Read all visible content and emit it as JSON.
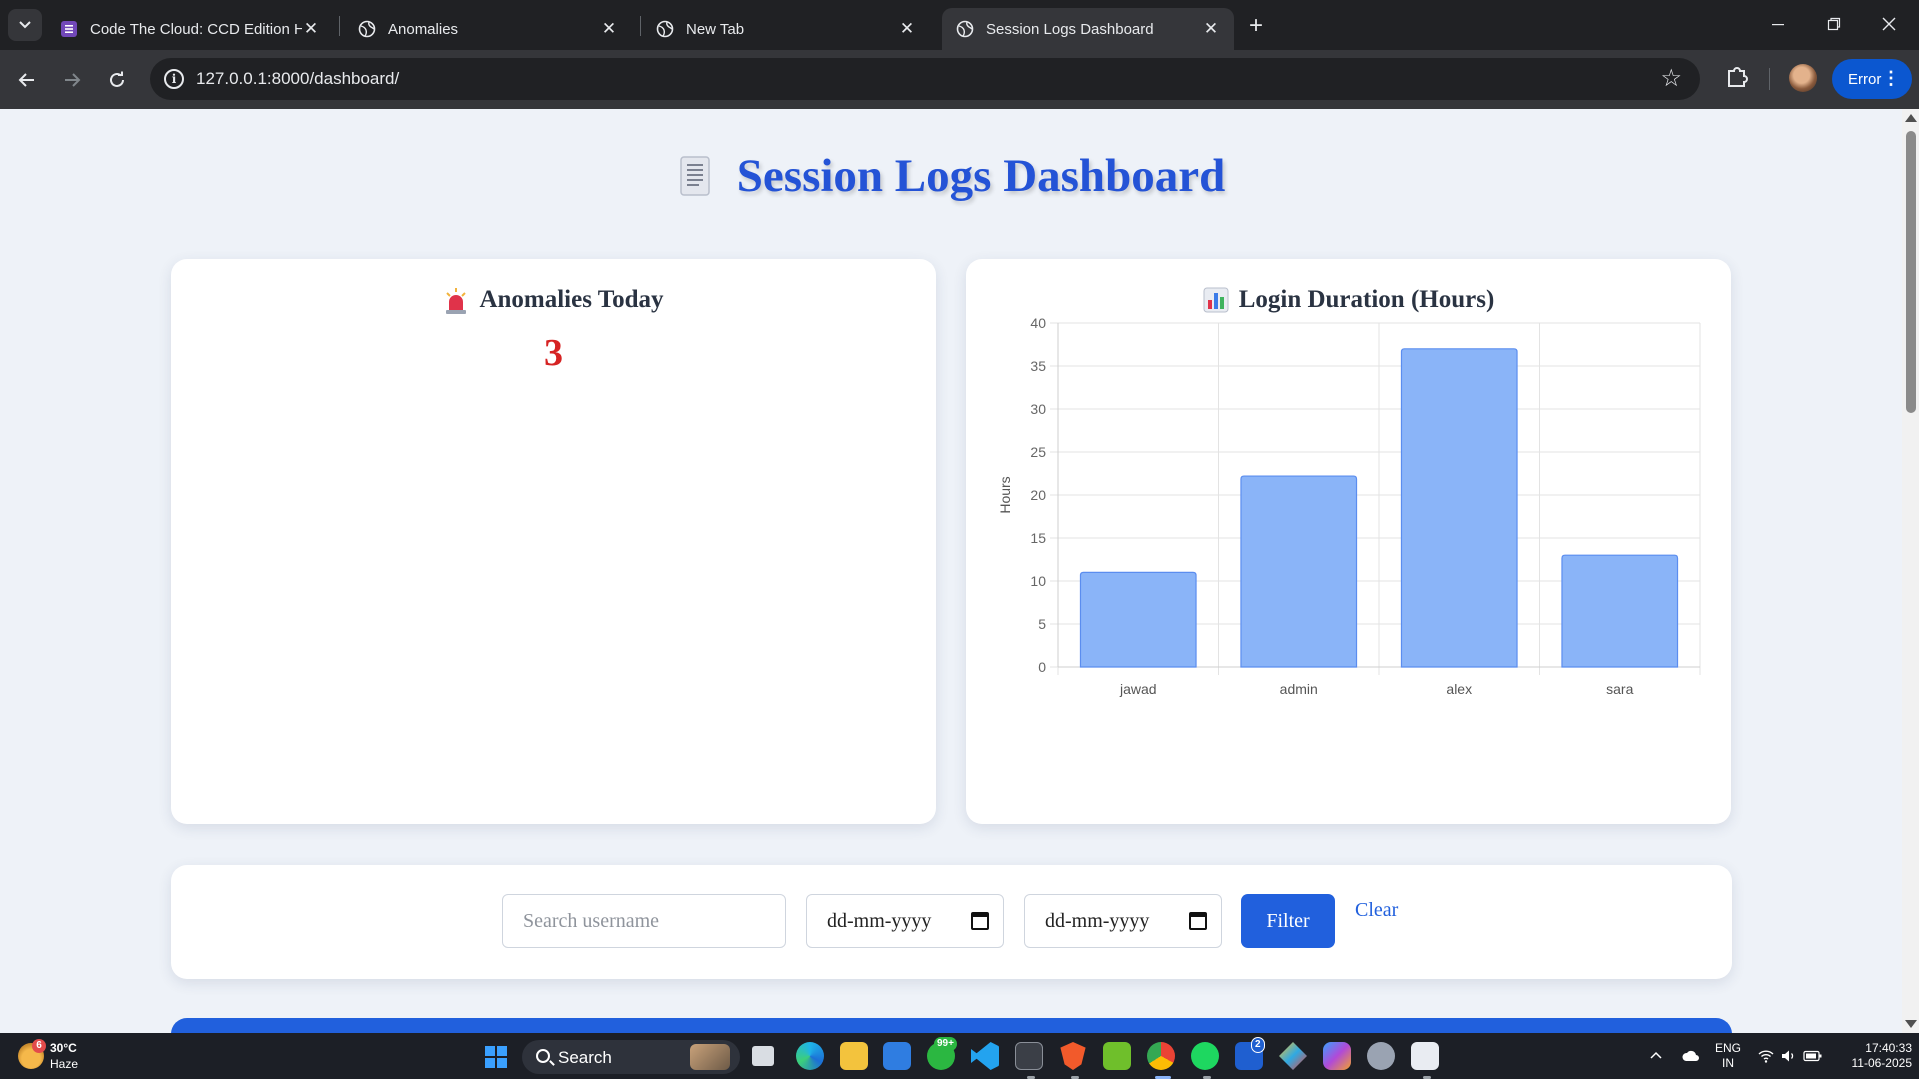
{
  "browser": {
    "tabs": [
      {
        "title": "Code The Cloud: CCD Edition H",
        "active": false,
        "icon": "form-icon"
      },
      {
        "title": "Anomalies",
        "active": false,
        "icon": "globe-icon"
      },
      {
        "title": "New Tab",
        "active": false,
        "icon": "globe-icon"
      },
      {
        "title": "Session Logs Dashboard",
        "active": true,
        "icon": "globe-icon"
      }
    ],
    "url": "127.0.0.1:8000/dashboard/",
    "profile_status": "Error"
  },
  "page": {
    "title": "Session Logs Dashboard",
    "title_icon": "scroll-icon",
    "anomalies": {
      "heading": "Anomalies Today",
      "icon": "siren-icon",
      "count": "3"
    },
    "chart": {
      "heading": "Login Duration (Hours)",
      "icon": "bar-chart-icon"
    },
    "filter": {
      "search_placeholder": "Search username",
      "date_from": "dd-mm-yyyy",
      "date_to": "dd-mm-yyyy",
      "filter_label": "Filter",
      "clear_label": "Clear"
    }
  },
  "chart_data": {
    "type": "bar",
    "categories": [
      "jawad",
      "admin",
      "alex",
      "sara"
    ],
    "values": [
      11,
      22.2,
      37,
      13
    ],
    "ylabel": "Hours",
    "ylim": [
      0,
      40
    ],
    "yticks": [
      0,
      5,
      10,
      15,
      20,
      25,
      30,
      35,
      40
    ],
    "grid": true,
    "bar_color": "#8ab4f8",
    "bar_border": "#5b8def"
  },
  "taskbar": {
    "weather_temp": "30°C",
    "weather_desc": "Haze",
    "weather_badge": "6",
    "search_label": "Search",
    "whatsapp_badge": "99+",
    "l_badge": "2",
    "lang_1": "ENG",
    "lang_2": "IN",
    "time": "17:40:33",
    "date": "11-06-2025"
  },
  "colors": {
    "accent": "#2160dd",
    "title": "#2453d6",
    "anomaly": "#d62323",
    "page_bg": "#eef2f8"
  }
}
